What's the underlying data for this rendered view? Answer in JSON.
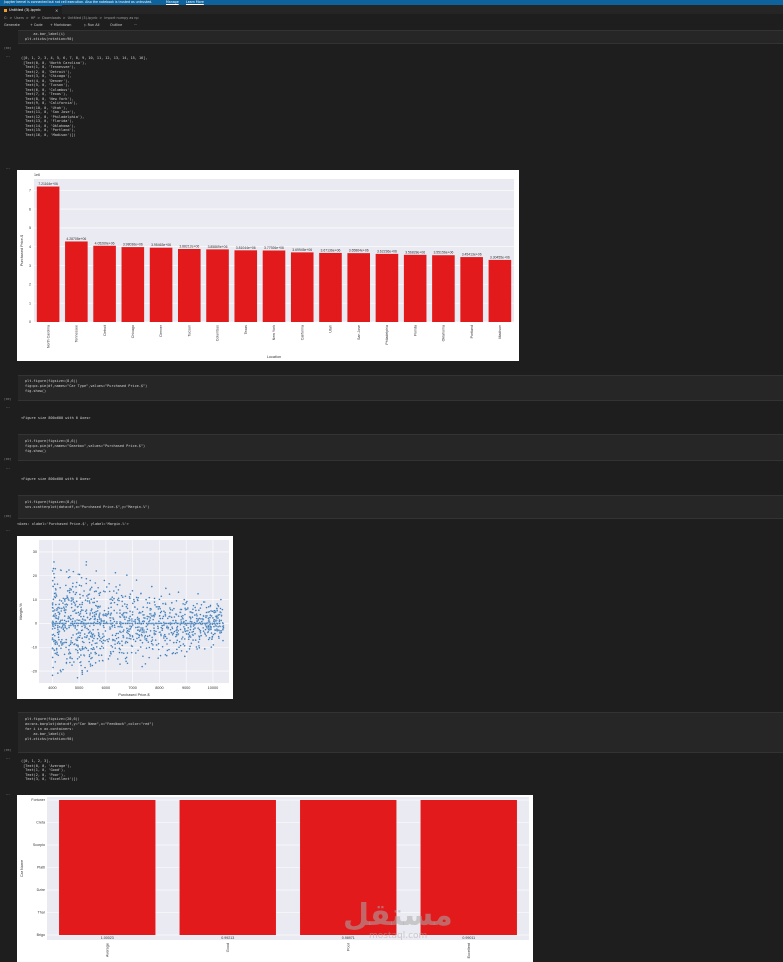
{
  "banner": {
    "message": "Jupyter kernel is connected but not cell execution. Also the notebook is trusted as untrusted.",
    "link1": "Manage",
    "link2": "Learn More"
  },
  "tab": {
    "title": "Untitled (3).ipynb",
    "close": "×"
  },
  "breadcrumb": [
    "C:",
    ">",
    "Users",
    ">",
    "HP",
    ">",
    "Downloads",
    ">",
    "Untitled (3).ipynb",
    ">",
    "import numpy as np"
  ],
  "toolbar": {
    "generate": "Generate",
    "code": "+ Code",
    "markdown": "+ Markdown",
    "run_all": "▷ Run All",
    "outline": "Outline",
    "more": "···"
  },
  "cells": {
    "cell1_lines": [
      "    ax.bar_label(i)",
      "plt.xticks(rotation=90)"
    ],
    "cell1_exec": "[00]",
    "out1_lines": [
      "([0, 1, 2, 3, 4, 5, 6, 7, 8, 9, 10, 11, 12, 13, 14, 15, 16],",
      " [Text(0, 0, 'North Carolina'),",
      "  Text(1, 0, 'Tennessee'),",
      "  Text(2, 0, 'Detroit'),",
      "  Text(3, 0, 'Chicago'),",
      "  Text(4, 0, 'Denver'),",
      "  Text(5, 0, 'Tucson'),",
      "  Text(6, 0, 'Columbus'),",
      "  Text(7, 0, 'Texas'),",
      "  Text(8, 0, 'New York'),",
      "  Text(9, 0, 'California'),",
      "  Text(10, 0, 'Utah'),",
      "  Text(11, 0, 'San Jose'),",
      "  Text(12, 0, 'Philadelphia'),",
      "  Text(13, 0, 'Florida'),",
      "  Text(14, 0, 'Oklahoma'),",
      "  Text(15, 0, 'Portland'),",
      "  Text(16, 0, 'Madison')])"
    ],
    "cell2_lines": [
      "plt.figure(figsize=(8,6))",
      "fig=px.pie(df,names=\"Car Type\",values=\"Purchased Price-$\")",
      "fig.show()"
    ],
    "cell2_exec": "[00]",
    "out2": "<Figure size 800x600 with 0 Axes>",
    "cell3_lines": [
      "plt.figure(figsize=(8,6))",
      "fig=px.pie(df,names=\"Gearbox\",values=\"Purchased Price-$\")",
      "fig.show()"
    ],
    "cell3_exec": "[00]",
    "out3": "<Figure size 800x600 with 0 Axes>",
    "cell4_lines": [
      "plt.figure(figsize=(8,6))",
      "sns.scatterplot(data=df,x=\"Purchased Price-$\",y=\"Margin-%\")"
    ],
    "cell4_exec": "[00]",
    "out4": "<Axes: xlabel='Purchased Price-$', ylabel='Margin-%'>",
    "cell5_lines": [
      "plt.figure(figsize=(20,6))",
      "ax=sns.barplot(data=df,y=\"Car Name\",x=\"Feedback\",color=\"red\")",
      "for i in ax.containers:",
      "    ax.bar_label(i)",
      "plt.xticks(rotation=90)"
    ],
    "cell5_exec": "[00]",
    "out5_lines": [
      "([0, 1, 2, 3],",
      " [Text(0, 0, 'Average'),",
      "  Text(1, 0, 'Good'),",
      "  Text(2, 0, 'Poor'),",
      "  Text(3, 0, 'Excellent')])"
    ]
  },
  "chart_data": [
    {
      "type": "bar",
      "title": "1e6",
      "xlabel": "Location",
      "ylabel": "Purchased Price-$",
      "categories": [
        "North Carolina",
        "Tennessee",
        "Detroit",
        "Chicago",
        "Denver",
        "Tucson",
        "Columbus",
        "Texas",
        "New York",
        "California",
        "Utah",
        "San Jose",
        "Philadelphia",
        "Florida",
        "Oklahoma",
        "Portland",
        "Madison"
      ],
      "values": [
        7.2,
        4.28,
        4.05,
        3.98,
        3.95,
        3.88,
        3.86,
        3.81,
        3.8,
        3.7,
        3.67,
        3.66,
        3.62,
        3.57,
        3.55,
        3.45,
        3.3
      ],
      "labels": [
        "7.21164e+06",
        "4.28705e+06",
        "4.05269e+06",
        "3.98036e+06",
        "3.95463e+06",
        "3.88212e+06",
        "3.85869e+06",
        "3.81044e+06",
        "3.77926e+06",
        "3.69945e+06",
        "3.67136e+06",
        "3.65864e+06",
        "3.62236e+06",
        "3.56828e+06",
        "3.55156e+06",
        "3.45413e+06",
        "3.30455e+06"
      ],
      "yticks": [
        0,
        1,
        2,
        3,
        4,
        5,
        6,
        7
      ],
      "ylim": [
        0,
        7.6
      ],
      "color": "#e31a1c"
    },
    {
      "type": "scatter",
      "xlabel": "Purchased Price-$",
      "ylabel": "Margin-%",
      "xticks": [
        4000,
        5000,
        6000,
        7000,
        8000,
        9000,
        10000
      ],
      "yticks": [
        -20,
        -10,
        0,
        10,
        20,
        30
      ],
      "xlim": [
        3500,
        10600
      ],
      "ylim": [
        -25,
        35
      ],
      "color": "#3a78b5",
      "grid": true
    },
    {
      "type": "bar",
      "xlabel": "",
      "ylabel": "Car Name",
      "categories": [
        "Average",
        "Good",
        "Poor",
        "Excellent"
      ],
      "labels": [
        "1.00023",
        "0.99213",
        "0.98971",
        "0.99011"
      ],
      "yticks": [
        "Fortuner",
        "Creta",
        "Scorpio",
        "Platti",
        "Dzire",
        "Thar",
        "Brigo"
      ],
      "color": "#e31a1c"
    }
  ],
  "watermark": {
    "main": "مستقل",
    "sub": "mostaql.com"
  }
}
